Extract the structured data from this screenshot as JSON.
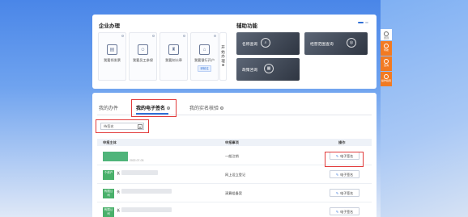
{
  "enterprise_section": {
    "title": "企业办理",
    "items": [
      {
        "icon": "id-card-icon",
        "label": "我要领发票",
        "badge": ""
      },
      {
        "icon": "user-card-icon",
        "label": "我要员工参保",
        "badge": ""
      },
      {
        "icon": "stamp-icon",
        "label": "我要刻公章",
        "badge": ""
      },
      {
        "icon": "bank-icon",
        "label": "我要银行开户",
        "badge": "请前往"
      }
    ],
    "more_label": [
      "开",
      "始",
      "办",
      "理"
    ],
    "more_icon_text": "⊕"
  },
  "aux_section": {
    "title": "辅助功能",
    "tools": [
      {
        "label": "名称查询",
        "icon": "search-icon"
      },
      {
        "label": "经营范围查询",
        "icon": "fingerprint-icon"
      },
      {
        "label": "政策咨询",
        "icon": "document-icon"
      }
    ]
  },
  "float_panel": [
    {
      "label": "置顶",
      "icon": "arrow-up-icon"
    },
    {
      "label": "导航",
      "icon": "compass-icon"
    },
    {
      "label": "咨询",
      "icon": "chat-icon"
    },
    {
      "label": "操作指南",
      "icon": "play-icon"
    }
  ],
  "tabs": [
    {
      "label": "我的办件",
      "info": false
    },
    {
      "label": "我的电子签名",
      "info": true
    },
    {
      "label": "我的实名核验",
      "info": true
    }
  ],
  "filter": {
    "value": "待签名",
    "arrow": "▾"
  },
  "table": {
    "headers": {
      "subject": "申报主体",
      "matter": "申报事项",
      "action": "操作"
    },
    "rows": [
      {
        "tag": "",
        "name": "",
        "sub": "2022-07-03",
        "matter": "一般注销",
        "action": "电子签名"
      },
      {
        "tag": "个体户",
        "name": "长",
        "sub": "",
        "matter": "网上设立登记",
        "action": "电子签名"
      },
      {
        "tag": "有限公司",
        "name": "长",
        "sub": "",
        "matter": "清算组备案",
        "action": "电子签名"
      },
      {
        "tag": "有限公司",
        "name": "长",
        "sub": "",
        "matter": "",
        "action": "电子签名"
      }
    ]
  }
}
